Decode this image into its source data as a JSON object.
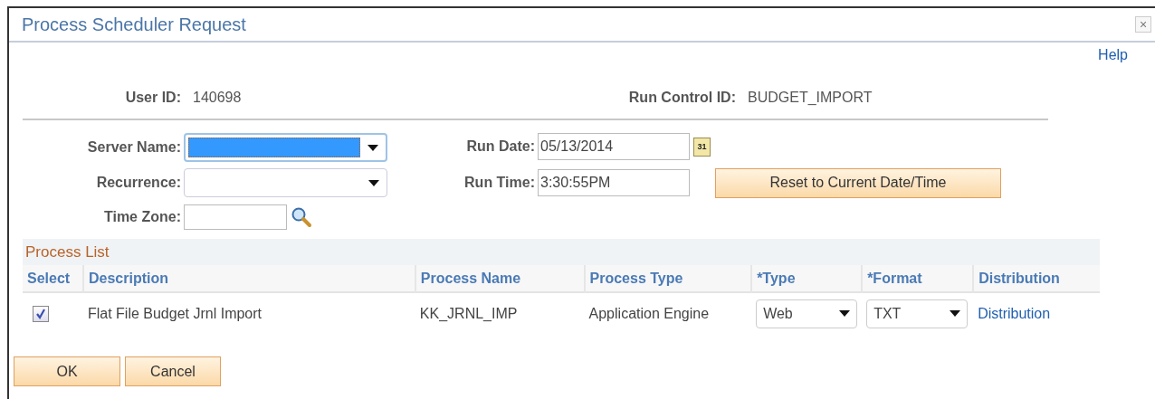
{
  "window": {
    "title": "Process Scheduler Request",
    "close": "×"
  },
  "help_link": "Help",
  "user_id": {
    "label": "User ID:",
    "value": "140698"
  },
  "run_control_id": {
    "label": "Run Control ID:",
    "value": "BUDGET_IMPORT"
  },
  "server_name": {
    "label": "Server Name:",
    "highlighted": true
  },
  "recurrence": {
    "label": "Recurrence:",
    "highlighted": false
  },
  "time_zone": {
    "label": "Time Zone:"
  },
  "run_date": {
    "label": "Run Date:",
    "value": "05/13/2014",
    "calendar_icon": "31"
  },
  "run_time": {
    "label": "Run Time:",
    "value": "3:30:55PM"
  },
  "reset_button": "Reset to Current Date/Time",
  "process_list": {
    "title": "Process List",
    "columns": [
      "Select",
      "Description",
      "Process Name",
      "Process Type",
      "*Type",
      "*Format",
      "Distribution"
    ],
    "rows": [
      {
        "checked": true,
        "description": "Flat File Budget Jrnl Import",
        "process_name": "KK_JRNL_IMP",
        "process_type": "Application Engine",
        "type": "Web",
        "format": "TXT",
        "distribution": "Distribution"
      }
    ]
  },
  "buttons": [
    "OK",
    "Cancel"
  ]
}
